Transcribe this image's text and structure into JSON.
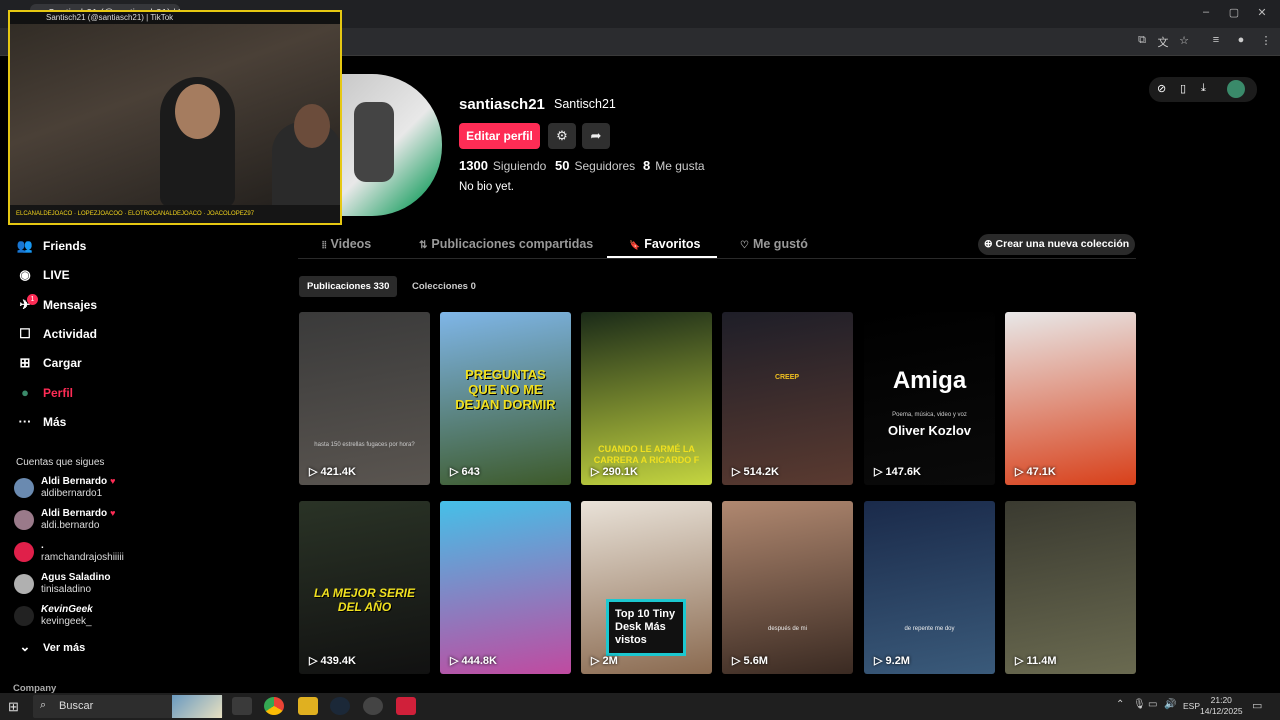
{
  "browser": {
    "tab_title": "Santisch21 (@santiasch21) | TikTok",
    "win_controls": [
      "–",
      "▢",
      "✕"
    ],
    "addr_icons": [
      "⧉",
      "文",
      "☆",
      "≡",
      "●",
      "⋮"
    ]
  },
  "webcam": {
    "strip_text": "ELCANALDEJOACO  ·  LOPEZJOACOO  ·  ELOTROCANALDEJOACO  ·  JOACOLOPEZ97",
    "title": "Santisch21 (@santiasch21) | TikTok"
  },
  "profile": {
    "username": "santiasch21",
    "nickname": "Santisch21",
    "edit_label": "Editar perfil",
    "stats": [
      {
        "value": "1300",
        "label": "Siguiendo"
      },
      {
        "value": "50",
        "label": "Seguidores"
      },
      {
        "value": "8",
        "label": "Me gusta"
      }
    ],
    "bio": "No bio yet."
  },
  "tabs": [
    {
      "label": "Videos",
      "icon": "⦙⦙"
    },
    {
      "label": "Publicaciones compartidas",
      "icon": "⇅"
    },
    {
      "label": "Favoritos",
      "icon": "🔖"
    },
    {
      "label": "Me gustó",
      "icon": "♡"
    }
  ],
  "new_collection": "Crear una nueva colección",
  "subtabs": [
    "Publicaciones 330",
    "Colecciones 0"
  ],
  "videos": [
    {
      "views": "421.4K",
      "caption": "hasta 150 estrellas fugaces por hora?",
      "color1": "#3a3a3a",
      "color2": "#5a5550"
    },
    {
      "views": "643",
      "caption": "PREGUNTAS QUE NO ME DEJAN DORMIR",
      "color1": "#7fb6e8",
      "color2": "#3d5a2a"
    },
    {
      "views": "290.1K",
      "caption": "CUANDO LE ARMÉ LA CARRERA A RICARDO F",
      "color1": "#1a2a18",
      "color2": "#c5d640"
    },
    {
      "views": "514.2K",
      "caption": "CREEP",
      "color1": "#1e1e28",
      "color2": "#5a3a30"
    },
    {
      "views": "147.6K",
      "caption": "Amiga",
      "subcaption": "Poema, música, video y voz",
      "author": "Oliver Kozlov",
      "color1": "#000000",
      "color2": "#0a0a0a"
    },
    {
      "views": "47.1K",
      "caption": "",
      "color1": "#e8e8e8",
      "color2": "#d8401a"
    },
    {
      "views": "439.4K",
      "caption": "LA MEJOR SERIE DEL AÑO",
      "color1": "#2a3326",
      "color2": "#111"
    },
    {
      "views": "444.8K",
      "caption": "",
      "color1": "#45c0e8",
      "color2": "#c04aa0"
    },
    {
      "views": "2M",
      "caption": "Top 10 Tiny Desk Más vistos",
      "color1": "#e9e2d8",
      "color2": "#8a6a50"
    },
    {
      "views": "5.6M",
      "caption": "después de mi",
      "color1": "#b08870",
      "color2": "#3a2a22"
    },
    {
      "views": "9.2M",
      "caption": "de repente me doy",
      "color1": "#1a2a4a",
      "color2": "#3a5a7a"
    },
    {
      "views": "11.4M",
      "caption": "",
      "color1": "#3a3a30",
      "color2": "#6a6a50"
    }
  ],
  "sidebar": {
    "items": [
      {
        "label": "Friends",
        "icon": "👥"
      },
      {
        "label": "LIVE",
        "icon": "◉"
      },
      {
        "label": "Mensajes",
        "icon": "✈"
      },
      {
        "label": "Actividad",
        "icon": "☐"
      },
      {
        "label": "Cargar",
        "icon": "⊞"
      },
      {
        "label": "Perfil",
        "icon": "●"
      },
      {
        "label": "Más",
        "icon": "···"
      }
    ],
    "messages_badge": "1",
    "following_title": "Cuentas que sigues",
    "following": [
      {
        "name": "Aldi Bernardo",
        "handle": "aldibernardo1",
        "verified": true,
        "color": "#6a8ab0"
      },
      {
        "name": "Aldi Bernardo",
        "handle": "aldi.bernardo",
        "verified": true,
        "color": "#9a7a8a"
      },
      {
        "name": ".",
        "handle": "ramchandrajoshiiiii",
        "verified": false,
        "color": "#e0204a"
      },
      {
        "name": "Agus Saladino",
        "handle": "tinisaladino",
        "verified": false,
        "color": "#b0b0b0"
      },
      {
        "name": "KevinGeek",
        "handle": "kevingeek_",
        "verified": false,
        "color": "#222"
      }
    ],
    "see_more": "Ver más",
    "company": "Company"
  },
  "taskbar": {
    "search_placeholder": "Buscar",
    "lang": "ESP",
    "time": "21:20",
    "date": "14/12/2025"
  },
  "colors": {
    "accent": "#fe2c55",
    "bg": "#000000"
  }
}
